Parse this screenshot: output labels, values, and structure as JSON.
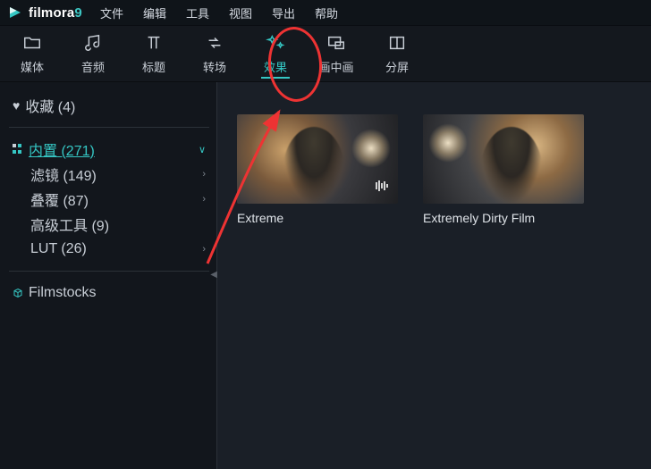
{
  "brand": {
    "name": "filmora",
    "version": "9"
  },
  "menubar": [
    "文件",
    "编辑",
    "工具",
    "视图",
    "导出",
    "帮助"
  ],
  "toolbar": [
    {
      "key": "media",
      "label": "媒体",
      "icon": "folder-icon"
    },
    {
      "key": "audio",
      "label": "音频",
      "icon": "music-icon"
    },
    {
      "key": "title",
      "label": "标题",
      "icon": "text-icon"
    },
    {
      "key": "trans",
      "label": "转场",
      "icon": "swap-icon"
    },
    {
      "key": "effect",
      "label": "效果",
      "icon": "sparkle-icon",
      "active": true
    },
    {
      "key": "pip",
      "label": "画中画",
      "icon": "pip-icon"
    },
    {
      "key": "split",
      "label": "分屏",
      "icon": "split-icon"
    }
  ],
  "sidebar": {
    "favorites": {
      "label": "收藏",
      "count": 4
    },
    "builtin": {
      "label": "内置",
      "count": 271,
      "expanded": true,
      "children": [
        {
          "key": "filter",
          "label": "滤镜",
          "count": 149
        },
        {
          "key": "overlay",
          "label": "叠覆",
          "count": 87
        },
        {
          "key": "adv",
          "label": "高级工具",
          "count": 9
        },
        {
          "key": "lut",
          "label": "LUT",
          "count": 26
        }
      ]
    },
    "filmstocks": {
      "label": "Filmstocks"
    }
  },
  "content": {
    "items": [
      {
        "title": "Extreme"
      },
      {
        "title": "Extremely Dirty Film"
      }
    ]
  },
  "annotation": {
    "target_tool": "effect"
  }
}
